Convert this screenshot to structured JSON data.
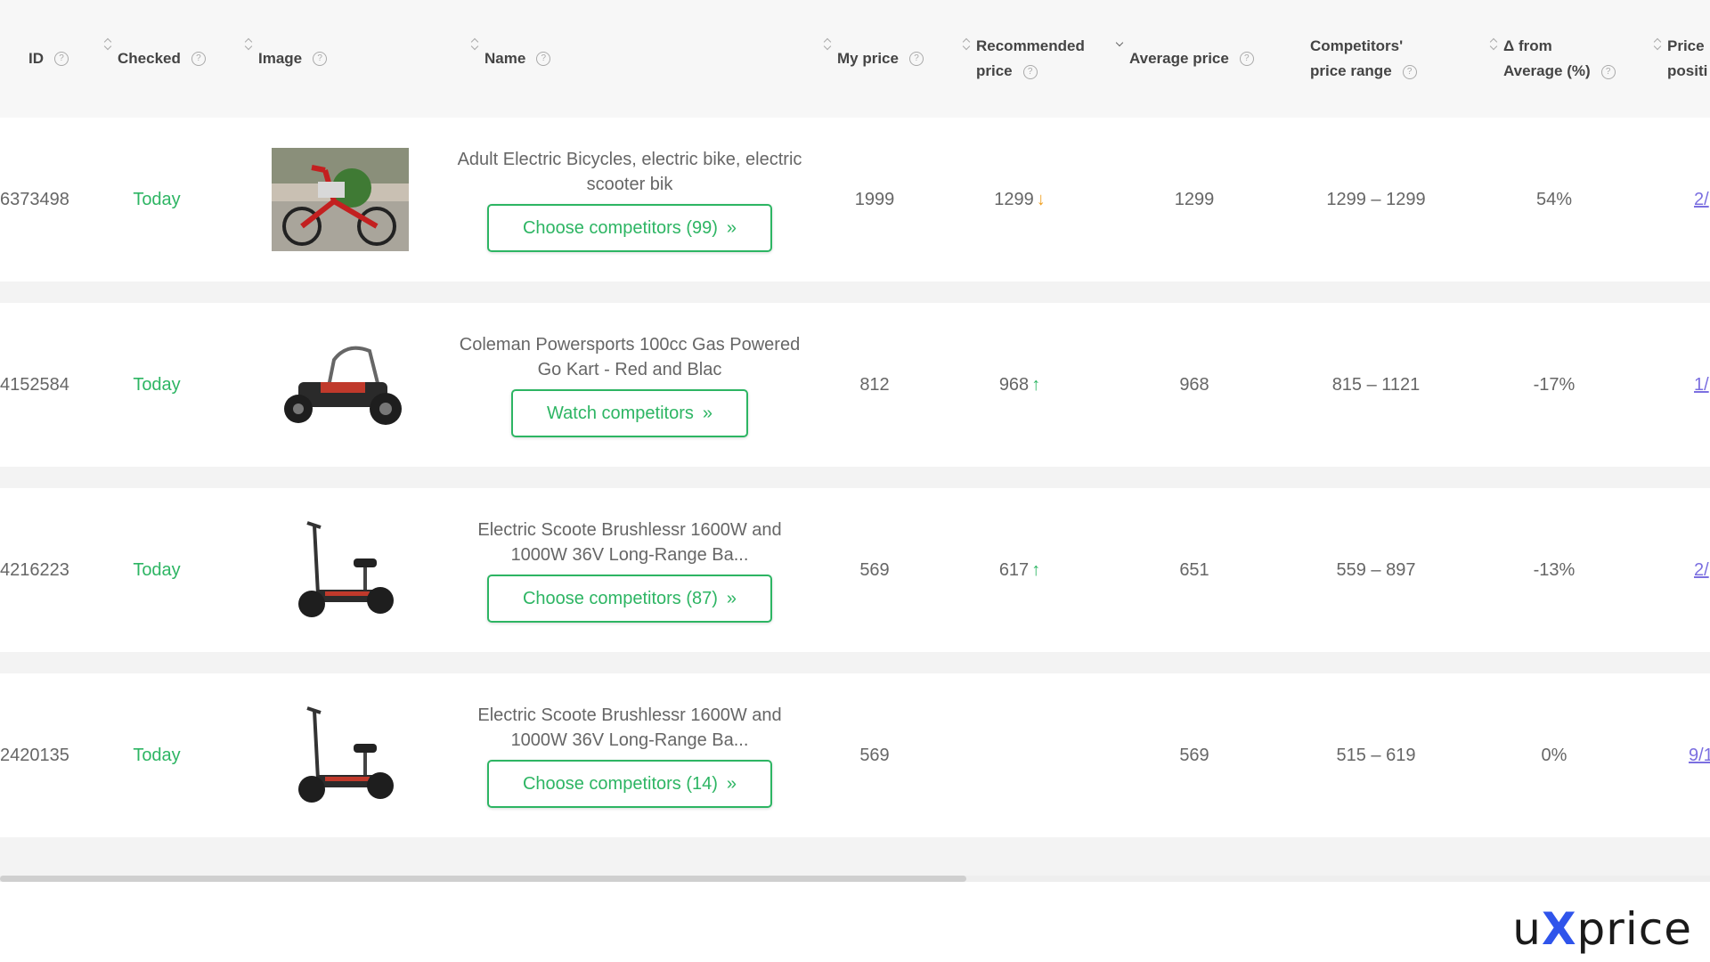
{
  "header": {
    "id": "ID",
    "checked": "Checked",
    "image": "Image",
    "name": "Name",
    "my_price": "My price",
    "recommended_1": "Recommended",
    "recommended_2": "price",
    "average_price": "Average price",
    "range_1": "Competitors'",
    "range_2": "price range",
    "delta_1": "Δ from",
    "delta_2": "Average (%)",
    "position_1": "Price",
    "position_2": "positi"
  },
  "help_glyph": "?",
  "rows": [
    {
      "id": "6373498",
      "checked": "Today",
      "name": "Adult Electric Bicycles, electric bike, electric scooter bik",
      "button": "Choose competitors (99)",
      "my_price": "1999",
      "recommended": "1299",
      "rec_arrow": "↓",
      "average": "1299",
      "range": "1299 – 1299",
      "delta": "54%",
      "position": "2/",
      "image": "bicycle"
    },
    {
      "id": "4152584",
      "checked": "Today",
      "name": "Coleman Powersports 100cc Gas Powered Go Kart - Red and Blac",
      "button": "Watch competitors",
      "my_price": "812",
      "recommended": "968",
      "rec_arrow": "↑",
      "average": "968",
      "range": "815 – 1121",
      "delta": "-17%",
      "position": "1/",
      "image": "go-kart"
    },
    {
      "id": "4216223",
      "checked": "Today",
      "name": "Electric Scoote Brushlessr 1600W and 1000W 36V Long-Range Ba...",
      "button": "Choose competitors (87)",
      "my_price": "569",
      "recommended": "617",
      "rec_arrow": "↑",
      "average": "651",
      "range": "559 – 897",
      "delta": "-13%",
      "position": "2/",
      "image": "scooter"
    },
    {
      "id": "2420135",
      "checked": "Today",
      "name": "Electric Scoote Brushlessr 1600W and 1000W 36V Long-Range Ba...",
      "button": "Choose competitors (14)",
      "my_price": "569",
      "recommended": "",
      "rec_arrow": "",
      "average": "569",
      "range": "515 – 619",
      "delta": "0%",
      "position": "9/1",
      "image": "scooter"
    }
  ],
  "button_chevron": "»",
  "logo": {
    "pre": "u",
    "x": "X",
    "post": "price"
  }
}
